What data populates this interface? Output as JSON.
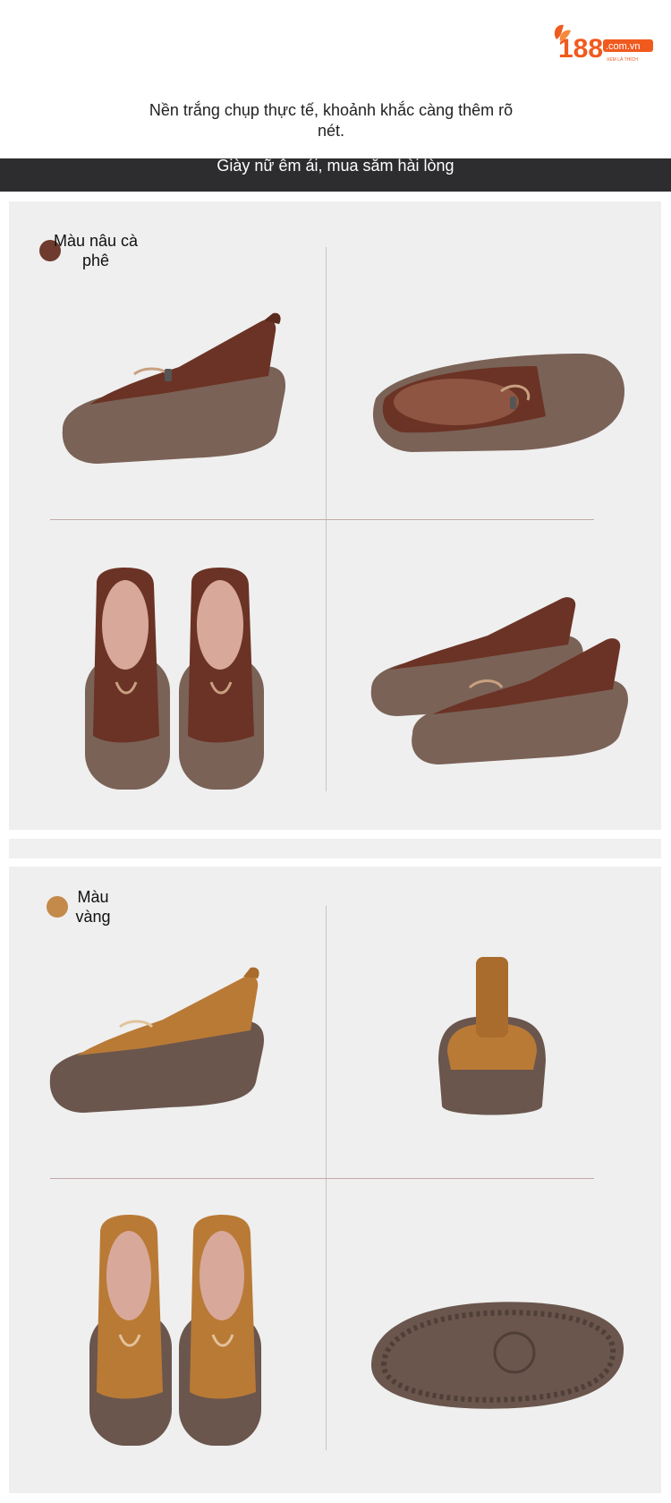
{
  "brand": {
    "logo_text": "188",
    "logo_domain": ".com.vn",
    "tagline": "XEM LÀ THÍCH"
  },
  "intro": {
    "text": "Nền trắng chụp thực tế, khoảnh khắc càng thêm rõ nét."
  },
  "banner": {
    "text": "Giày nữ êm ái, mua sắm hài lòng"
  },
  "colors_sections": [
    {
      "label": "Màu nâu cà phê",
      "swatch": "#6e3b2e"
    },
    {
      "label": "Màu vàng",
      "swatch": "#c48a4a"
    }
  ],
  "palette": {
    "brand_orange": "#f05a1e",
    "banner_bg": "#2d2d30",
    "panel_bg": "#efefef",
    "coffee_upper": "#6b3325",
    "yellow_upper": "#b97a36",
    "sole": "#7a6257"
  }
}
